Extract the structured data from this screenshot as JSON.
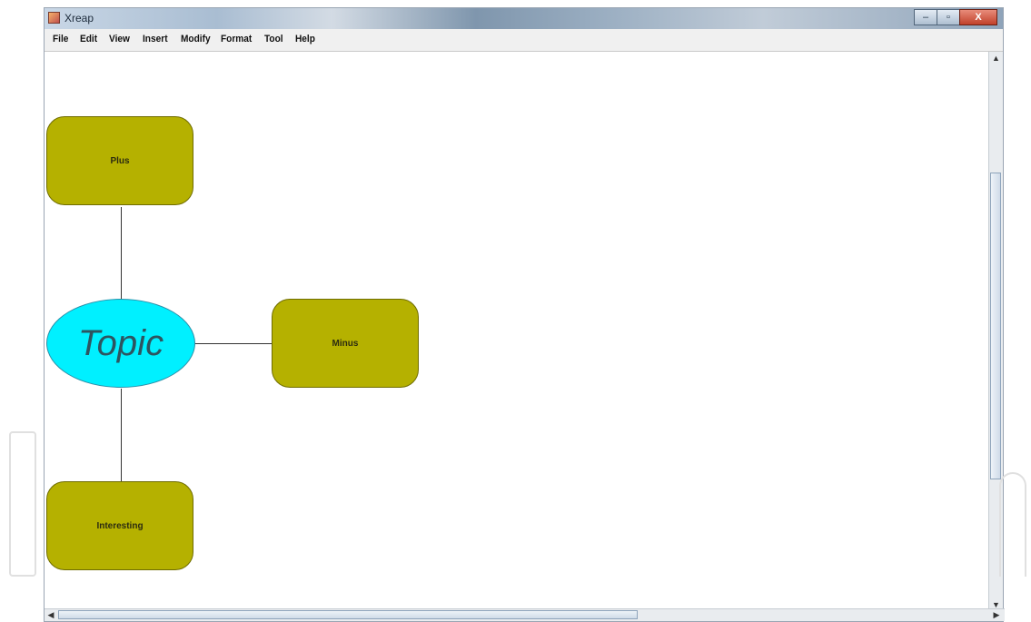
{
  "window": {
    "title": "Xreap",
    "controls": {
      "minimize": "–",
      "maximize": "▫",
      "close": "X"
    }
  },
  "menu": [
    "File",
    "Edit",
    "View",
    "Insert",
    "Modify",
    "Format",
    "Tool",
    "Help"
  ],
  "mindmap": {
    "topic": "Topic",
    "nodes": {
      "plus": "Plus",
      "minus": "Minus",
      "interesting": "Interesting"
    }
  },
  "colors": {
    "topic_fill": "#00f0ff",
    "node_fill": "#b5b100"
  },
  "icons": {
    "app": "java-cup-icon",
    "scroll_up": "arrow-up-icon",
    "scroll_down": "arrow-down-icon",
    "scroll_left": "arrow-left-icon",
    "scroll_right": "arrow-right-icon"
  }
}
